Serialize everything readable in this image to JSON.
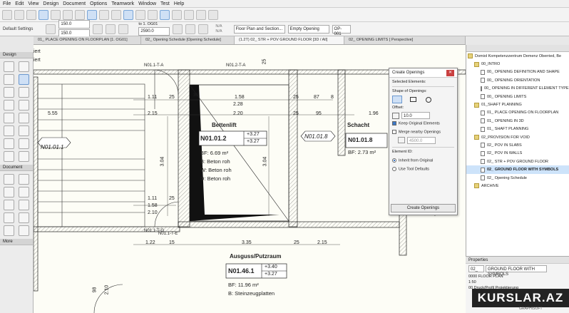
{
  "menu": [
    "File",
    "Edit",
    "View",
    "Design",
    "Document",
    "Options",
    "Teamwork",
    "Window",
    "Test",
    "Help"
  ],
  "infobar": {
    "label": "Default Settings",
    "field_top": "150.0",
    "field_bottom": "150.0",
    "elev_label": "to 1. OG01",
    "elev_value": "2590.0",
    "na1": "N/A",
    "na2": "N/A",
    "view_type": "Floor Plan and Section...",
    "opening_type": "Empty Opening",
    "id_value": "OP-001"
  },
  "tabs": [
    "01_ PLACE OPENING ON FLOORPLAN [1. OG01]",
    "02_ Opening Schedule [Opening Schedule]",
    "(1.2T) 02_ STR + POV GROUND FLOOR [3D / All]",
    "02_ OPENING LIMITS [ Perspective]"
  ],
  "toolbox": {
    "design": "Design",
    "document": "Document",
    "more": "More"
  },
  "dialog": {
    "title": "Create Openings",
    "selected": "Selected Elements:",
    "shape": "Shape of Openings:",
    "offset": "Offset:",
    "offset_value": "10.0",
    "keep": "Keep Original Elements",
    "merge": "Merge nearby Openings",
    "merge_value": "4500.0",
    "element_id": "Element ID:",
    "inherit": "Inherit from Original",
    "use_tool": "Use Tool Defaults",
    "button": "Create Openings"
  },
  "navigator": {
    "root": "Domiol Kompetenzzentrum Demenz Oberried, Be",
    "items": [
      {
        "label": "00_INTRO",
        "type": "folder",
        "indent": 1
      },
      {
        "label": "00_ OPENING DEFINITION AND SHAPE",
        "type": "page",
        "indent": 2
      },
      {
        "label": "00_ OPENING ORIENTATION",
        "type": "page",
        "indent": 2
      },
      {
        "label": "00_ OPENING IN DIFFERENT ELEMENT TYPES",
        "type": "page",
        "indent": 2
      },
      {
        "label": "00_ OPENING LIMITS",
        "type": "page",
        "indent": 2
      },
      {
        "label": "01_SHAFT PLANNING",
        "type": "folder",
        "indent": 1
      },
      {
        "label": "01_ PLACE OPENING ON FLOORPLAN",
        "type": "page",
        "indent": 2
      },
      {
        "label": "01_ OPENING IN 3D",
        "type": "page",
        "indent": 2
      },
      {
        "label": "01_ SHAFT PLANNING",
        "type": "page",
        "indent": 2
      },
      {
        "label": "02_PROVISION FOR VOID",
        "type": "folder",
        "indent": 1
      },
      {
        "label": "02_ POV IN SLABS",
        "type": "page",
        "indent": 2
      },
      {
        "label": "02_ POV IN WALLS",
        "type": "page",
        "indent": 2
      },
      {
        "label": "02_ STR + POV GROUND FLOOR",
        "type": "page",
        "indent": 2
      },
      {
        "label": "02_ GROUND FLOOR WITH SYMBOLS",
        "type": "page",
        "indent": 2,
        "selected": true
      },
      {
        "label": "02_ Opening Schedule",
        "type": "page",
        "indent": 2
      },
      {
        "label": "ARCHIVE",
        "type": "folder",
        "indent": 1
      }
    ]
  },
  "properties": {
    "title": "Properties",
    "id": "02_",
    "name": "GROUND FLOOR WITH SYMBOLS",
    "floor": "0000 FLOOR PLAN",
    "scale": "1:50",
    "layer": "00 Druck/Profil Projektierung"
  },
  "plan": {
    "rooms": [
      {
        "id": "N01.01.2",
        "name": "Bettenlift",
        "area": "BF: 6.69 m²",
        "B": "B: Beton roh",
        "W": "W: Beton roh",
        "D": "D: Beton roh",
        "h1": "+3.27",
        "h2": "+3.27"
      },
      {
        "id": "N01.01.8",
        "name": "Schacht",
        "area": "BF: 2.73 m²"
      },
      {
        "id": "N01.46.1",
        "name": "Ausguss/Putzraum",
        "area": "BF: 11.96 m²",
        "B": "B: Steinzeugplatten",
        "h1": "+3.40",
        "h2": "+3.27"
      }
    ],
    "tags": [
      "N01.01.1",
      "N01.01.8",
      "N01.1-T-A",
      "N01.2-T-A",
      "N01.1-T-E",
      "N01.1-T-G"
    ],
    "dims": [
      "1.11",
      "25",
      "30",
      "1.58",
      "25",
      "87",
      "8",
      "2.28",
      "5.55",
      "2.15",
      "2.20",
      "25",
      "95",
      "1.96",
      "3.04",
      "1.11",
      "25",
      "1.58",
      "2.10",
      "3.04",
      "1.22",
      "15",
      "3.35",
      "25",
      "2.15",
      "98",
      "2.10",
      "25"
    ],
    "header_label": "iert",
    "header_label2": "iert"
  },
  "watermark": {
    "main": "KURSLAR.AZ",
    "sub": "GRAPHISOFT"
  }
}
